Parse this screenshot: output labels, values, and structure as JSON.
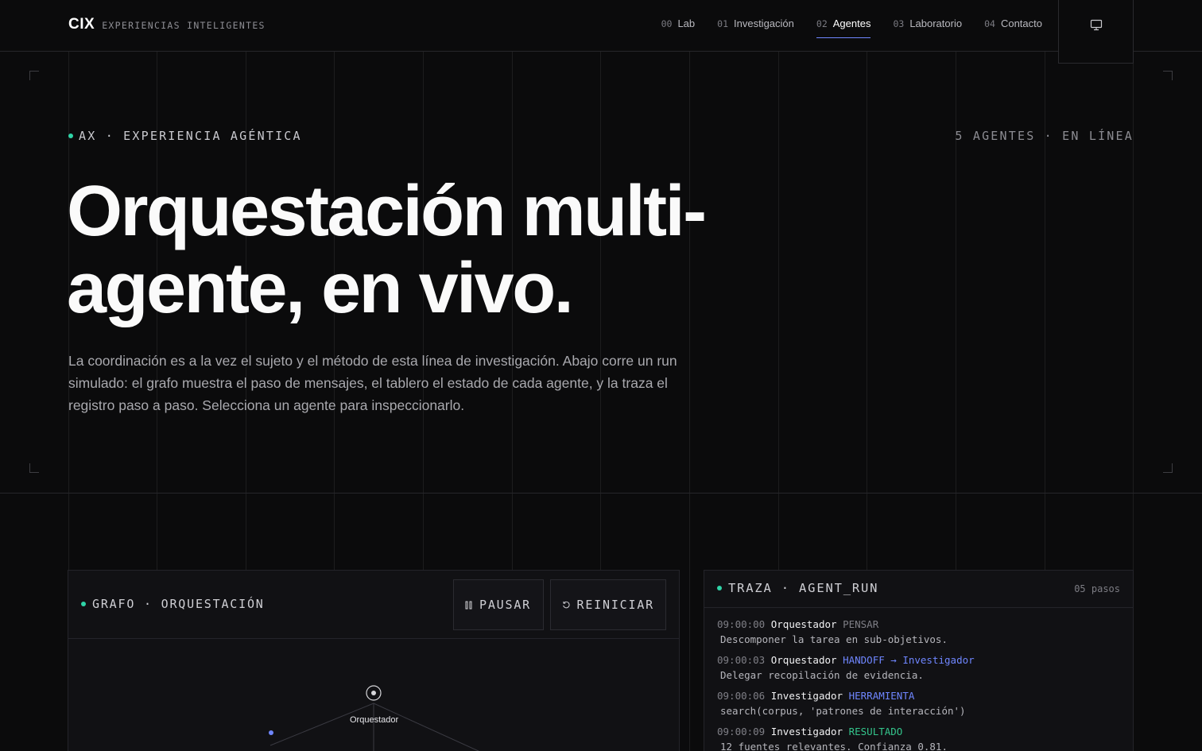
{
  "brand": {
    "logo": "CIX",
    "tagline": "EXPERIENCIAS INTELIGENTES"
  },
  "nav": [
    {
      "num": "00",
      "label": "Lab",
      "active": false
    },
    {
      "num": "01",
      "label": "Investigación",
      "active": false
    },
    {
      "num": "02",
      "label": "Agentes",
      "active": true
    },
    {
      "num": "03",
      "label": "Laboratorio",
      "active": false
    },
    {
      "num": "04",
      "label": "Contacto",
      "active": false
    }
  ],
  "header": {
    "display_icon": "monitor-icon"
  },
  "hero": {
    "eyebrow": "AX · EXPERIENCIA AGÉNTICA",
    "status": "5 AGENTES · EN LÍNEA",
    "title_line1": "Orquestación multi-",
    "title_line2": "agente, en vivo.",
    "description": "La coordinación es a la vez el sujeto y el método de esta línea de investigación. Abajo corre un run simulado: el grafo muestra el paso de mensajes, el tablero el estado de cada agente, y la traza el registro paso a paso. Selecciona un agente para inspeccionarlo."
  },
  "graph": {
    "label": "GRAFO · ORQUESTACIÓN",
    "pause_label": "PAUSAR",
    "pause_icon": "pause-icon",
    "reset_label": "REINICIAR",
    "reset_icon": "refresh-icon",
    "node_orchestrator": "Orquestador"
  },
  "trace": {
    "label": "TRAZA · AGENT_RUN",
    "steps": "05 pasos",
    "entries": [
      {
        "time": "09:00:00",
        "agent": "Orquestador",
        "action": "PENSAR",
        "detail": "Descomponer la tarea en sub-objetivos."
      },
      {
        "time": "09:00:03",
        "agent": "Orquestador",
        "action": "HANDOFF → Investigador",
        "detail": "Delegar recopilación de evidencia."
      },
      {
        "time": "09:00:06",
        "agent": "Investigador",
        "action": "HERRAMIENTA",
        "detail": "search(corpus, 'patrones de interacción')"
      },
      {
        "time": "09:00:09",
        "agent": "Investigador",
        "action": "RESULTADO",
        "detail": "12 fuentes relevantes. Confianza 0.81."
      }
    ]
  },
  "colors": {
    "accent_green": "#2fd4a7",
    "accent_blue": "#6f86ff",
    "result_green": "#34c48b"
  }
}
